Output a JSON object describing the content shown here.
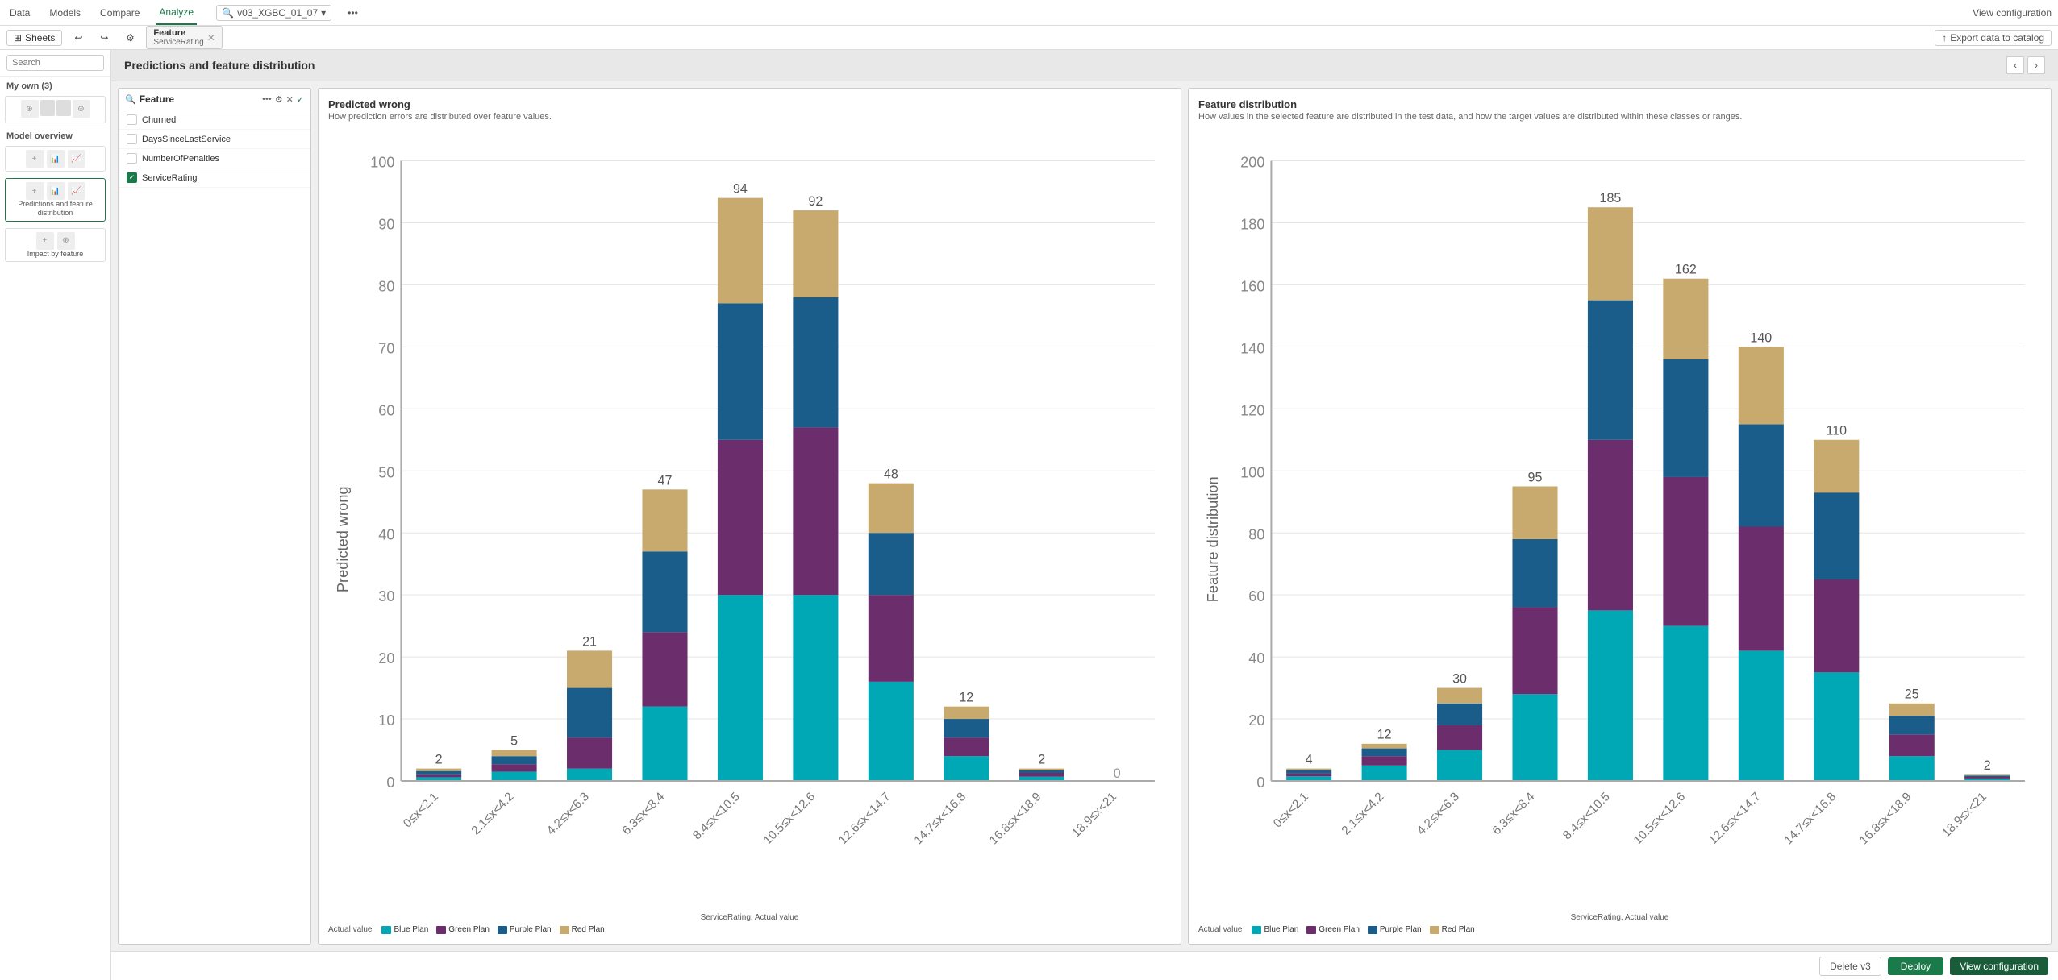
{
  "topNav": {
    "items": [
      "Data",
      "Models",
      "Compare",
      "Analyze"
    ],
    "activeItem": "Analyze",
    "searchText": "v03_XGBC_01_07",
    "viewConfig": "View configuration",
    "exportData": "Export data to catalog"
  },
  "secondBar": {
    "sheetsLabel": "Sheets",
    "tab": {
      "main": "Feature",
      "sub": "ServiceRating"
    },
    "icons": [
      "back",
      "forward",
      "settings"
    ]
  },
  "sidebar": {
    "searchPlaceholder": "Search",
    "sectionLabel": "My own (3)",
    "modelOverview": "Model overview",
    "predictionsLabel": "Predictions and feature distribution",
    "impactLabel": "Impact by feature"
  },
  "pageTitle": "Predictions and feature distribution",
  "featurePanel": {
    "title": "Feature",
    "items": [
      {
        "label": "Churned",
        "checked": false
      },
      {
        "label": "DaysSinceLastService",
        "checked": false
      },
      {
        "label": "NumberOfPenalties",
        "checked": false
      },
      {
        "label": "ServiceRating",
        "checked": true
      }
    ]
  },
  "leftChart": {
    "title": "Predicted wrong",
    "subtitle": "How prediction errors are distributed over feature values.",
    "yAxisLabel": "Predicted wrong",
    "xAxisLabel": "ServiceRating, Actual value",
    "yMax": 100,
    "bars": [
      {
        "label": "0≤x<2.1",
        "total": 2,
        "blue": 0.6,
        "green": 0.4,
        "purple": 0.6,
        "red": 0.4
      },
      {
        "label": "2.1≤x<4.2",
        "total": 5,
        "blue": 1.5,
        "green": 1.2,
        "purple": 1.3,
        "red": 1.0
      },
      {
        "label": "4.2≤x<6.3",
        "total": 21,
        "blue": 2,
        "green": 5,
        "purple": 8,
        "red": 6
      },
      {
        "label": "6.3≤x<8.4",
        "total": 47,
        "blue": 12,
        "green": 12,
        "purple": 13,
        "red": 10
      },
      {
        "label": "8.4≤x<10.5",
        "total": 94,
        "blue": 30,
        "green": 25,
        "purple": 22,
        "red": 17
      },
      {
        "label": "10.5≤x<12.6",
        "total": 92,
        "blue": 30,
        "green": 27,
        "purple": 21,
        "red": 14
      },
      {
        "label": "12.6≤x<14.7",
        "total": 48,
        "blue": 16,
        "green": 14,
        "purple": 10,
        "red": 8
      },
      {
        "label": "14.7≤x<16.8",
        "total": 12,
        "blue": 4,
        "green": 3,
        "purple": 3,
        "red": 2
      },
      {
        "label": "16.8≤x<18.9",
        "total": 2,
        "blue": 0.7,
        "green": 0.6,
        "purple": 0.4,
        "red": 0.3
      },
      {
        "label": "18.9≤x<21",
        "total": 0,
        "blue": 0,
        "green": 0,
        "purple": 0,
        "red": 0
      }
    ],
    "legendActual": "Actual value",
    "legend": [
      {
        "label": "Blue Plan",
        "color": "#00a8b5"
      },
      {
        "label": "Green Plan",
        "color": "#6b2d6b"
      },
      {
        "label": "Purple Plan",
        "color": "#1a5c8a"
      },
      {
        "label": "Red Plan",
        "color": "#c8a96e"
      }
    ]
  },
  "rightChart": {
    "title": "Feature distribution",
    "subtitle": "How values in the selected feature are distributed in the test data, and how the target values are distributed within these classes or ranges.",
    "yAxisLabel": "Feature distribution",
    "xAxisLabel": "ServiceRating, Actual value",
    "yMax": 200,
    "bars": [
      {
        "label": "0≤x<2.1",
        "total": 4,
        "blue": 1.5,
        "green": 1,
        "purple": 1,
        "red": 0.5
      },
      {
        "label": "2.1≤x<4.2",
        "total": 12,
        "blue": 5,
        "green": 3,
        "purple": 2.5,
        "red": 1.5
      },
      {
        "label": "4.2≤x<6.3",
        "total": 30,
        "blue": 10,
        "green": 8,
        "purple": 7,
        "red": 5
      },
      {
        "label": "6.3≤x<8.4",
        "total": 95,
        "blue": 28,
        "green": 28,
        "purple": 22,
        "red": 17
      },
      {
        "label": "8.4≤x<10.5",
        "total": 185,
        "blue": 55,
        "green": 55,
        "purple": 45,
        "red": 30
      },
      {
        "label": "10.5≤x<12.6",
        "total": 162,
        "blue": 50,
        "green": 48,
        "purple": 38,
        "red": 26
      },
      {
        "label": "12.6≤x<14.7",
        "total": 140,
        "blue": 42,
        "green": 40,
        "purple": 33,
        "red": 25
      },
      {
        "label": "14.7≤x<16.8",
        "total": 110,
        "blue": 35,
        "green": 30,
        "purple": 28,
        "red": 17
      },
      {
        "label": "16.8≤x<18.9",
        "total": 25,
        "blue": 8,
        "green": 7,
        "purple": 6,
        "red": 4
      },
      {
        "label": "18.9≤x<21",
        "total": 2,
        "blue": 0.8,
        "green": 0.5,
        "purple": 0.4,
        "red": 0.3
      }
    ],
    "legendActual": "Actual value",
    "legend": [
      {
        "label": "Blue Plan",
        "color": "#00a8b5"
      },
      {
        "label": "Green Plan",
        "color": "#6b2d6b"
      },
      {
        "label": "Purple Plan",
        "color": "#1a5c8a"
      },
      {
        "label": "Red Plan",
        "color": "#c8a96e"
      }
    ]
  },
  "bottomBar": {
    "deleteLabel": "Delete v3",
    "deployLabel": "Deploy",
    "viewConfigLabel": "View configuration"
  },
  "colors": {
    "blue": "#00a8b5",
    "green": "#6b2d6b",
    "purple": "#1a5c8a",
    "red": "#c8a96e",
    "accent": "#1a7a4a"
  }
}
